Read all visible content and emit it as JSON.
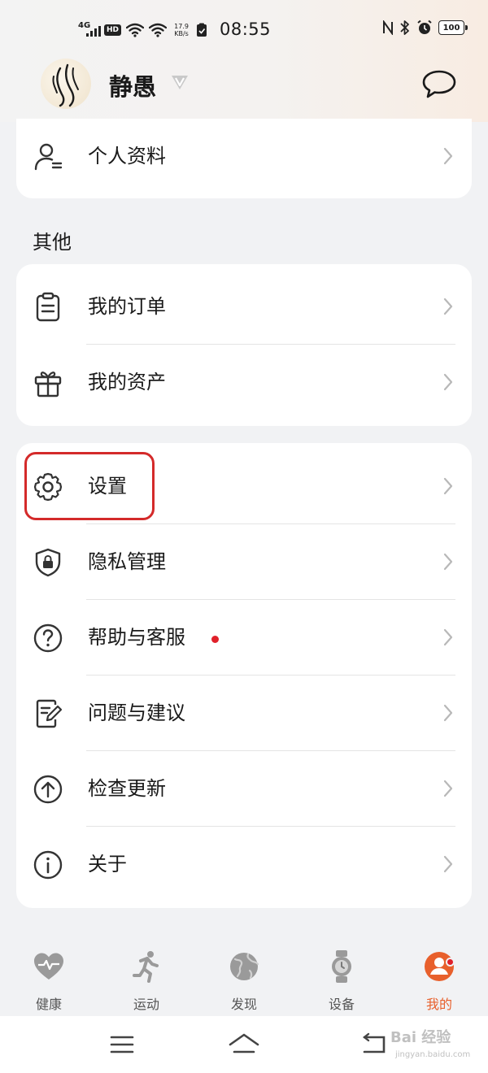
{
  "status_bar": {
    "network": "4G",
    "hd": "HD",
    "speed_value": "17.9",
    "speed_unit": "KB/s",
    "time": "08:55",
    "battery": "100"
  },
  "header": {
    "username": "静愚"
  },
  "profile_card": {
    "items": [
      {
        "label": "个人资料",
        "icon": "person-icon"
      }
    ]
  },
  "other_section": {
    "title": "其他",
    "items": [
      {
        "label": "我的订单",
        "icon": "clipboard-icon"
      },
      {
        "label": "我的资产",
        "icon": "gift-icon"
      }
    ]
  },
  "settings_card": {
    "items": [
      {
        "label": "设置",
        "icon": "gear-icon"
      },
      {
        "label": "隐私管理",
        "icon": "shield-lock-icon"
      },
      {
        "label": "帮助与客服",
        "icon": "question-icon"
      },
      {
        "label": "问题与建议",
        "icon": "edit-note-icon"
      },
      {
        "label": "检查更新",
        "icon": "arrow-up-circle-icon"
      },
      {
        "label": "关于",
        "icon": "info-icon"
      }
    ]
  },
  "bottom_nav": {
    "items": [
      {
        "label": "健康",
        "icon": "heart-icon"
      },
      {
        "label": "运动",
        "icon": "running-icon"
      },
      {
        "label": "发现",
        "icon": "globe-icon"
      },
      {
        "label": "设备",
        "icon": "watch-icon"
      },
      {
        "label": "我的",
        "icon": "profile-icon"
      }
    ],
    "active": "我的"
  },
  "watermark": {
    "text": "Bai 经验",
    "sub": "jingyan.baidu.com"
  },
  "colors": {
    "accent": "#e8602c",
    "highlight": "#d42a2a",
    "badge": "#e0202a",
    "card": "#ffffff",
    "background": "#f1f2f4"
  }
}
